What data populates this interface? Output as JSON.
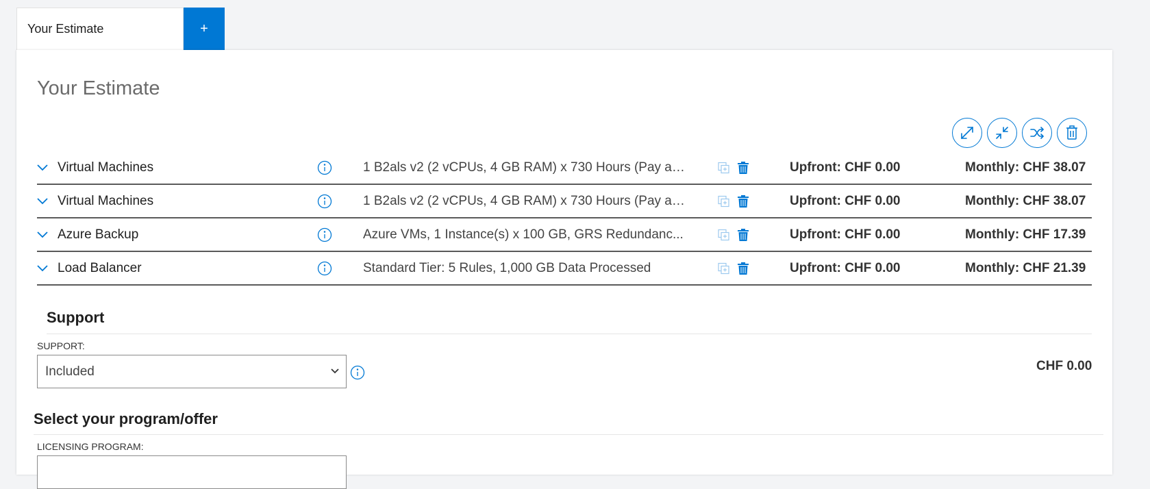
{
  "tabs": {
    "active_label": "Your Estimate",
    "add_label": "+"
  },
  "estimate": {
    "title": "Your Estimate"
  },
  "items": [
    {
      "name": "Virtual Machines",
      "description": "1 B2als v2 (2 vCPUs, 4 GB RAM) x 730 Hours (Pay as...",
      "upfront": "Upfront: CHF 0.00",
      "monthly": "Monthly: CHF 38.07"
    },
    {
      "name": "Virtual Machines",
      "description": "1 B2als v2 (2 vCPUs, 4 GB RAM) x 730 Hours (Pay as...",
      "upfront": "Upfront: CHF 0.00",
      "monthly": "Monthly: CHF 38.07"
    },
    {
      "name": "Azure Backup",
      "description": "Azure VMs, 1 Instance(s) x 100 GB, GRS Redundanc...",
      "upfront": "Upfront: CHF 0.00",
      "monthly": "Monthly: CHF 17.39"
    },
    {
      "name": "Load Balancer",
      "description": "Standard Tier: 5 Rules, 1,000 GB Data Processed",
      "upfront": "Upfront: CHF 0.00",
      "monthly": "Monthly: CHF 21.39"
    }
  ],
  "support": {
    "heading": "Support",
    "field_label": "SUPPORT:",
    "selected": "Included",
    "total": "CHF 0.00"
  },
  "program": {
    "heading": "Select your program/offer",
    "field_label": "LICENSING PROGRAM:"
  },
  "colors": {
    "accent": "#0078d4",
    "page_bg": "#f3f4f6"
  }
}
